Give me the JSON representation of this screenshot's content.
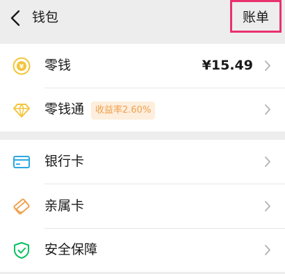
{
  "header": {
    "title": "钱包",
    "bill_label": "账单"
  },
  "group1": {
    "items": [
      {
        "label": "零钱",
        "value": "¥15.49",
        "icon": "yuan-coin-icon"
      },
      {
        "label": "零钱通",
        "badge": "收益率2.60%",
        "icon": "diamond-icon"
      }
    ]
  },
  "group2": {
    "items": [
      {
        "label": "银行卡",
        "icon": "bank-card-icon"
      },
      {
        "label": "亲属卡",
        "icon": "family-card-icon"
      },
      {
        "label": "安全保障",
        "icon": "shield-icon"
      }
    ]
  },
  "colors": {
    "background": "#ededed",
    "highlight_border": "#e8316d",
    "coin": "#f3c53a",
    "bank_card": "#2aa7e0",
    "family_card": "#f0a04b",
    "shield": "#07c160"
  }
}
